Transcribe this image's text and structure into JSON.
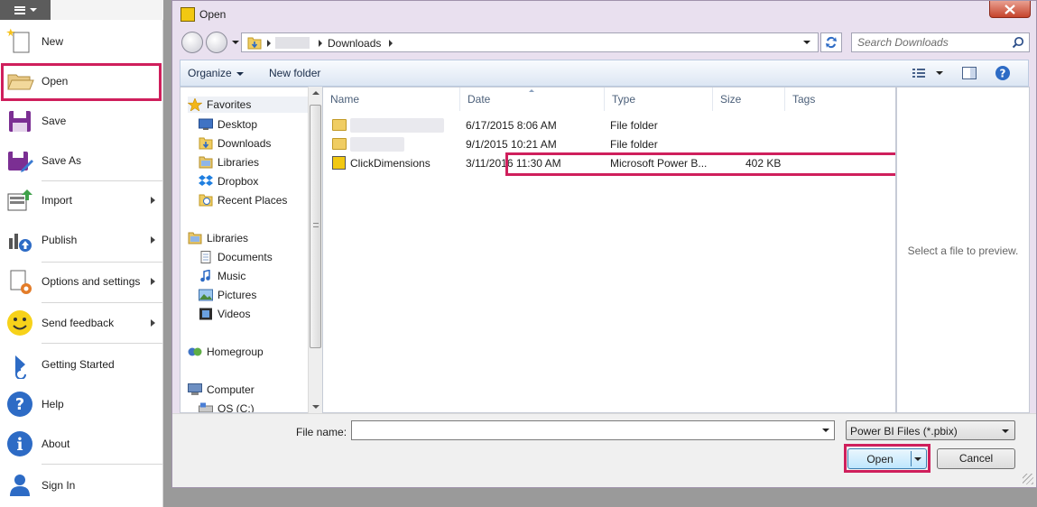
{
  "menu": {
    "items": [
      {
        "label": "New"
      },
      {
        "label": "Open"
      },
      {
        "label": "Save"
      },
      {
        "label": "Save As"
      },
      {
        "label": "Import"
      },
      {
        "label": "Publish"
      },
      {
        "label": "Options and settings"
      },
      {
        "label": "Send feedback"
      },
      {
        "label": "Getting Started"
      },
      {
        "label": "Help"
      },
      {
        "label": "About"
      },
      {
        "label": "Sign In"
      }
    ]
  },
  "dialog": {
    "title": "Open",
    "address": {
      "current_folder": "Downloads"
    },
    "search": {
      "placeholder": "Search Downloads"
    },
    "toolbar": {
      "organize": "Organize",
      "new_folder": "New folder"
    },
    "nav": {
      "favorites": "Favorites",
      "desktop": "Desktop",
      "downloads": "Downloads",
      "libraries_fav": "Libraries",
      "dropbox": "Dropbox",
      "recent": "Recent Places",
      "libraries": "Libraries",
      "documents": "Documents",
      "music": "Music",
      "pictures": "Pictures",
      "videos": "Videos",
      "homegroup": "Homegroup",
      "computer": "Computer",
      "os": "OS (C:)"
    },
    "columns": {
      "name": "Name",
      "date": "Date",
      "type": "Type",
      "size": "Size",
      "tags": "Tags"
    },
    "files": [
      {
        "name": "",
        "date": "6/17/2015 8:06 AM",
        "type": "File folder",
        "size": ""
      },
      {
        "name": "",
        "date": "9/1/2015 10:21 AM",
        "type": "File folder",
        "size": ""
      },
      {
        "name": "ClickDimensions",
        "date": "3/11/2016 11:30 AM",
        "type": "Microsoft Power B...",
        "size": "402 KB"
      }
    ],
    "preview_text": "Select a file to preview.",
    "file_name_label": "File name:",
    "file_name_value": "",
    "file_type": "Power BI Files (*.pbix)",
    "open_label": "Open",
    "cancel_label": "Cancel"
  },
  "colors": {
    "highlight": "#cf1f5c",
    "accent": "#3c7fb1",
    "dialog_frame": "#e9e0ef"
  }
}
